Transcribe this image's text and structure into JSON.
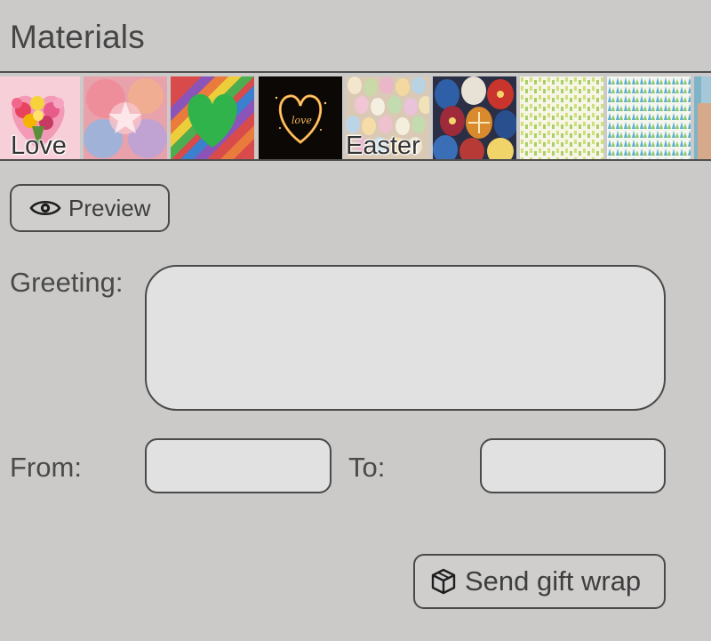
{
  "header": {
    "title": "Materials"
  },
  "materials": {
    "items": [
      {
        "name": "love-flowers",
        "label": "Love"
      },
      {
        "name": "pastel-hearts",
        "label": ""
      },
      {
        "name": "rainbow-heart",
        "label": ""
      },
      {
        "name": "sparkler-heart",
        "label": ""
      },
      {
        "name": "easter-eggs-candy",
        "label": "Easter"
      },
      {
        "name": "painted-easter-eggs",
        "label": ""
      },
      {
        "name": "pattern-yellow-green",
        "label": ""
      },
      {
        "name": "pattern-blue-green",
        "label": ""
      },
      {
        "name": "photo-partial",
        "label": ""
      }
    ]
  },
  "preview": {
    "label": "Preview",
    "icon": "eye-icon"
  },
  "form": {
    "greeting_label": "Greeting:",
    "greeting_value": "",
    "from_label": "From:",
    "from_value": "",
    "to_label": "To:",
    "to_value": ""
  },
  "send": {
    "label": "Send gift wrap",
    "icon": "package-icon"
  },
  "colors": {
    "background": "#cbcac9",
    "field_background": "#e1e1e1",
    "border": "#4a4a4a",
    "text": "#444444"
  }
}
